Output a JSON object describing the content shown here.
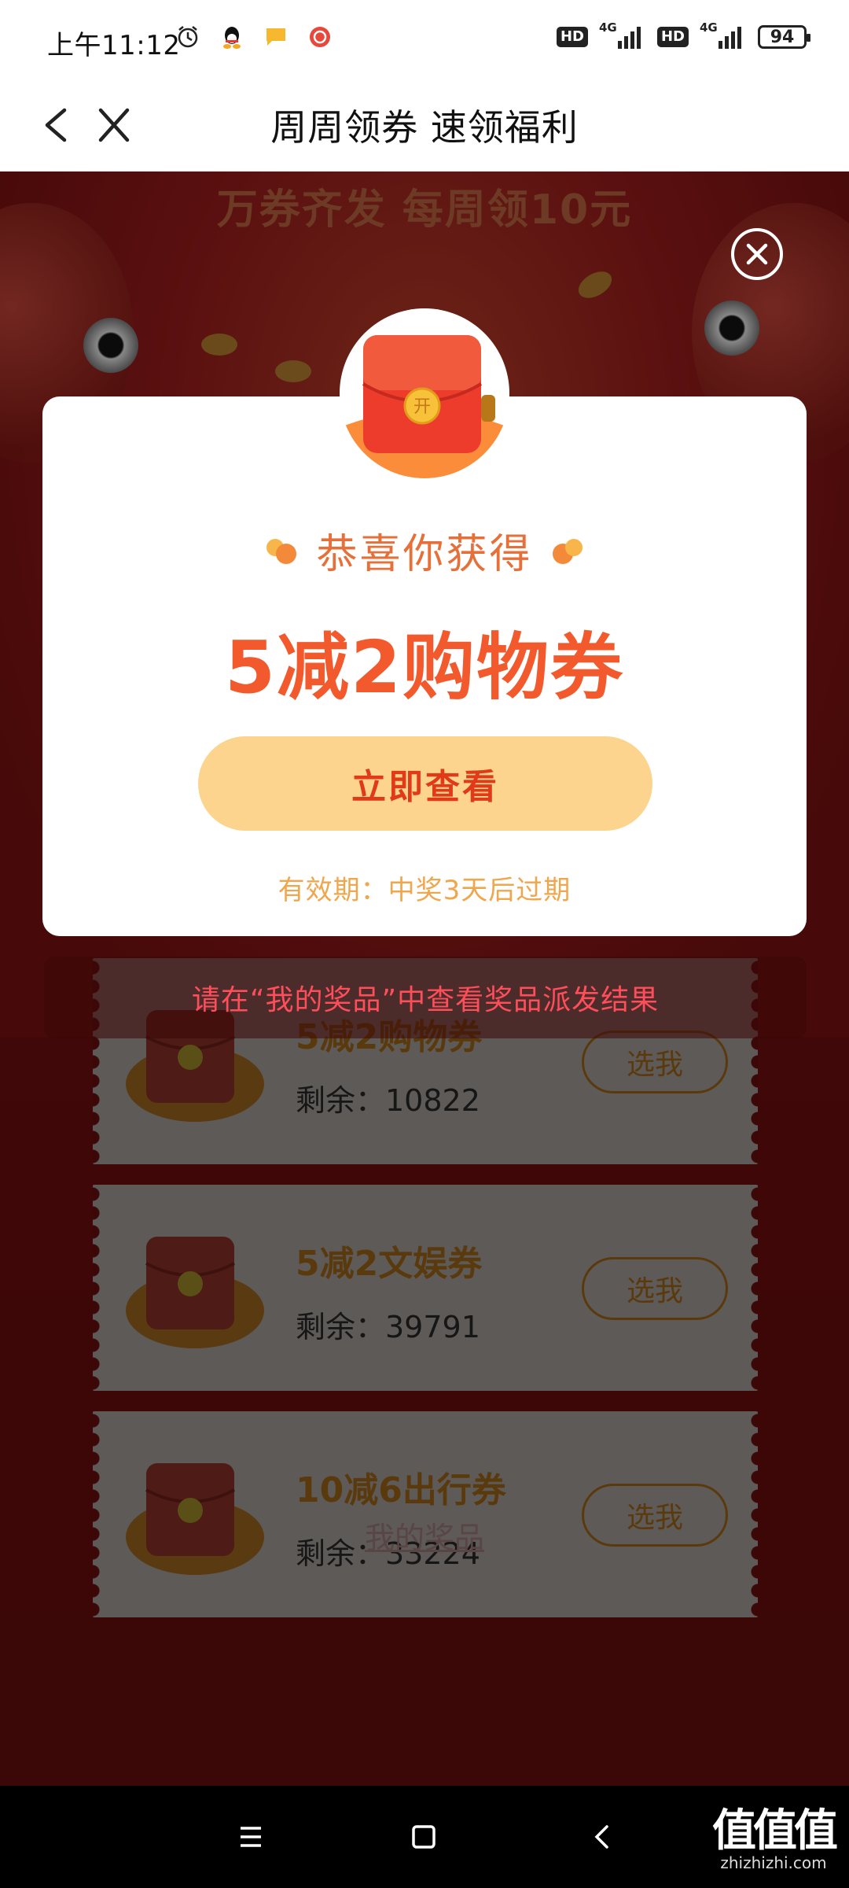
{
  "status_bar": {
    "time": "上午11:12",
    "battery": "94",
    "network_1": "4G",
    "network_2": "4G",
    "hd_1": "HD",
    "hd_2": "HD"
  },
  "nav": {
    "title": "周周领券 速领福利"
  },
  "hero": {
    "title": "万券齐发 每周领10元"
  },
  "modal": {
    "congrats": "恭喜你获得",
    "prize": "5减2购物券",
    "view_button": "立即查看",
    "validity": "有效期：中奖3天后过期",
    "envelope_mark": "开"
  },
  "notice": "请在“我的奖品”中查看奖品派发结果",
  "coupons": [
    {
      "name": "5减2购物券",
      "remaining": "剩余：10822",
      "button": "选我"
    },
    {
      "name": "5减2文娱券",
      "remaining": "剩余：39791",
      "button": "选我"
    },
    {
      "name": "10减6出行券",
      "remaining": "剩余：33224",
      "button": "选我"
    }
  ],
  "my_prizes_link": "我的奖品",
  "watermark": {
    "main": "值值值",
    "sub": "zhizhizhi.com"
  },
  "colors": {
    "accent_orange": "#f25a2d",
    "button_yellow": "#fcd48e",
    "notice_red": "#ff4d5a",
    "page_red": "#7b1212"
  }
}
